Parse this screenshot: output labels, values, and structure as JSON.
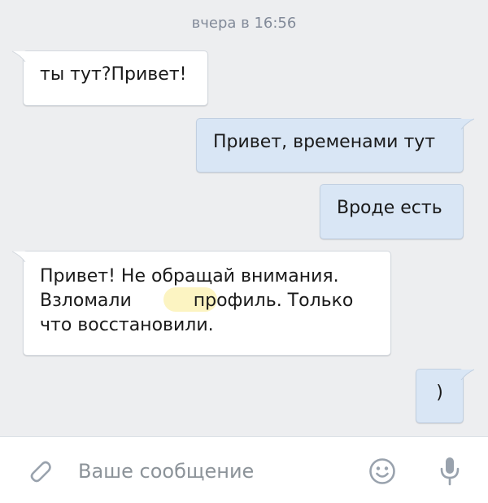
{
  "chat": {
    "date_separator": "вчера в 16:56",
    "messages": [
      {
        "direction": "incoming",
        "text": "ты тут?Привет!"
      },
      {
        "direction": "outgoing",
        "text": "Привет, временами тут"
      },
      {
        "direction": "outgoing",
        "text": "Вроде есть"
      },
      {
        "direction": "incoming",
        "lines": [
          "Привет! Не обращай внимания.",
          "Взломали",
          "профиль. Только",
          "что восстановили."
        ]
      },
      {
        "direction": "outgoing",
        "text": ")"
      }
    ]
  },
  "composer": {
    "placeholder": "Ваше сообщение",
    "attach_icon": "paperclip-icon",
    "emoji_icon": "smiley-icon",
    "mic_icon": "microphone-icon"
  },
  "colors": {
    "chat_background": "#edeef0",
    "incoming_bubble": "#ffffff",
    "outgoing_bubble": "#d9e6f5",
    "icon_gray": "#99a2ad",
    "redaction_mark": "#fcf4c2"
  }
}
